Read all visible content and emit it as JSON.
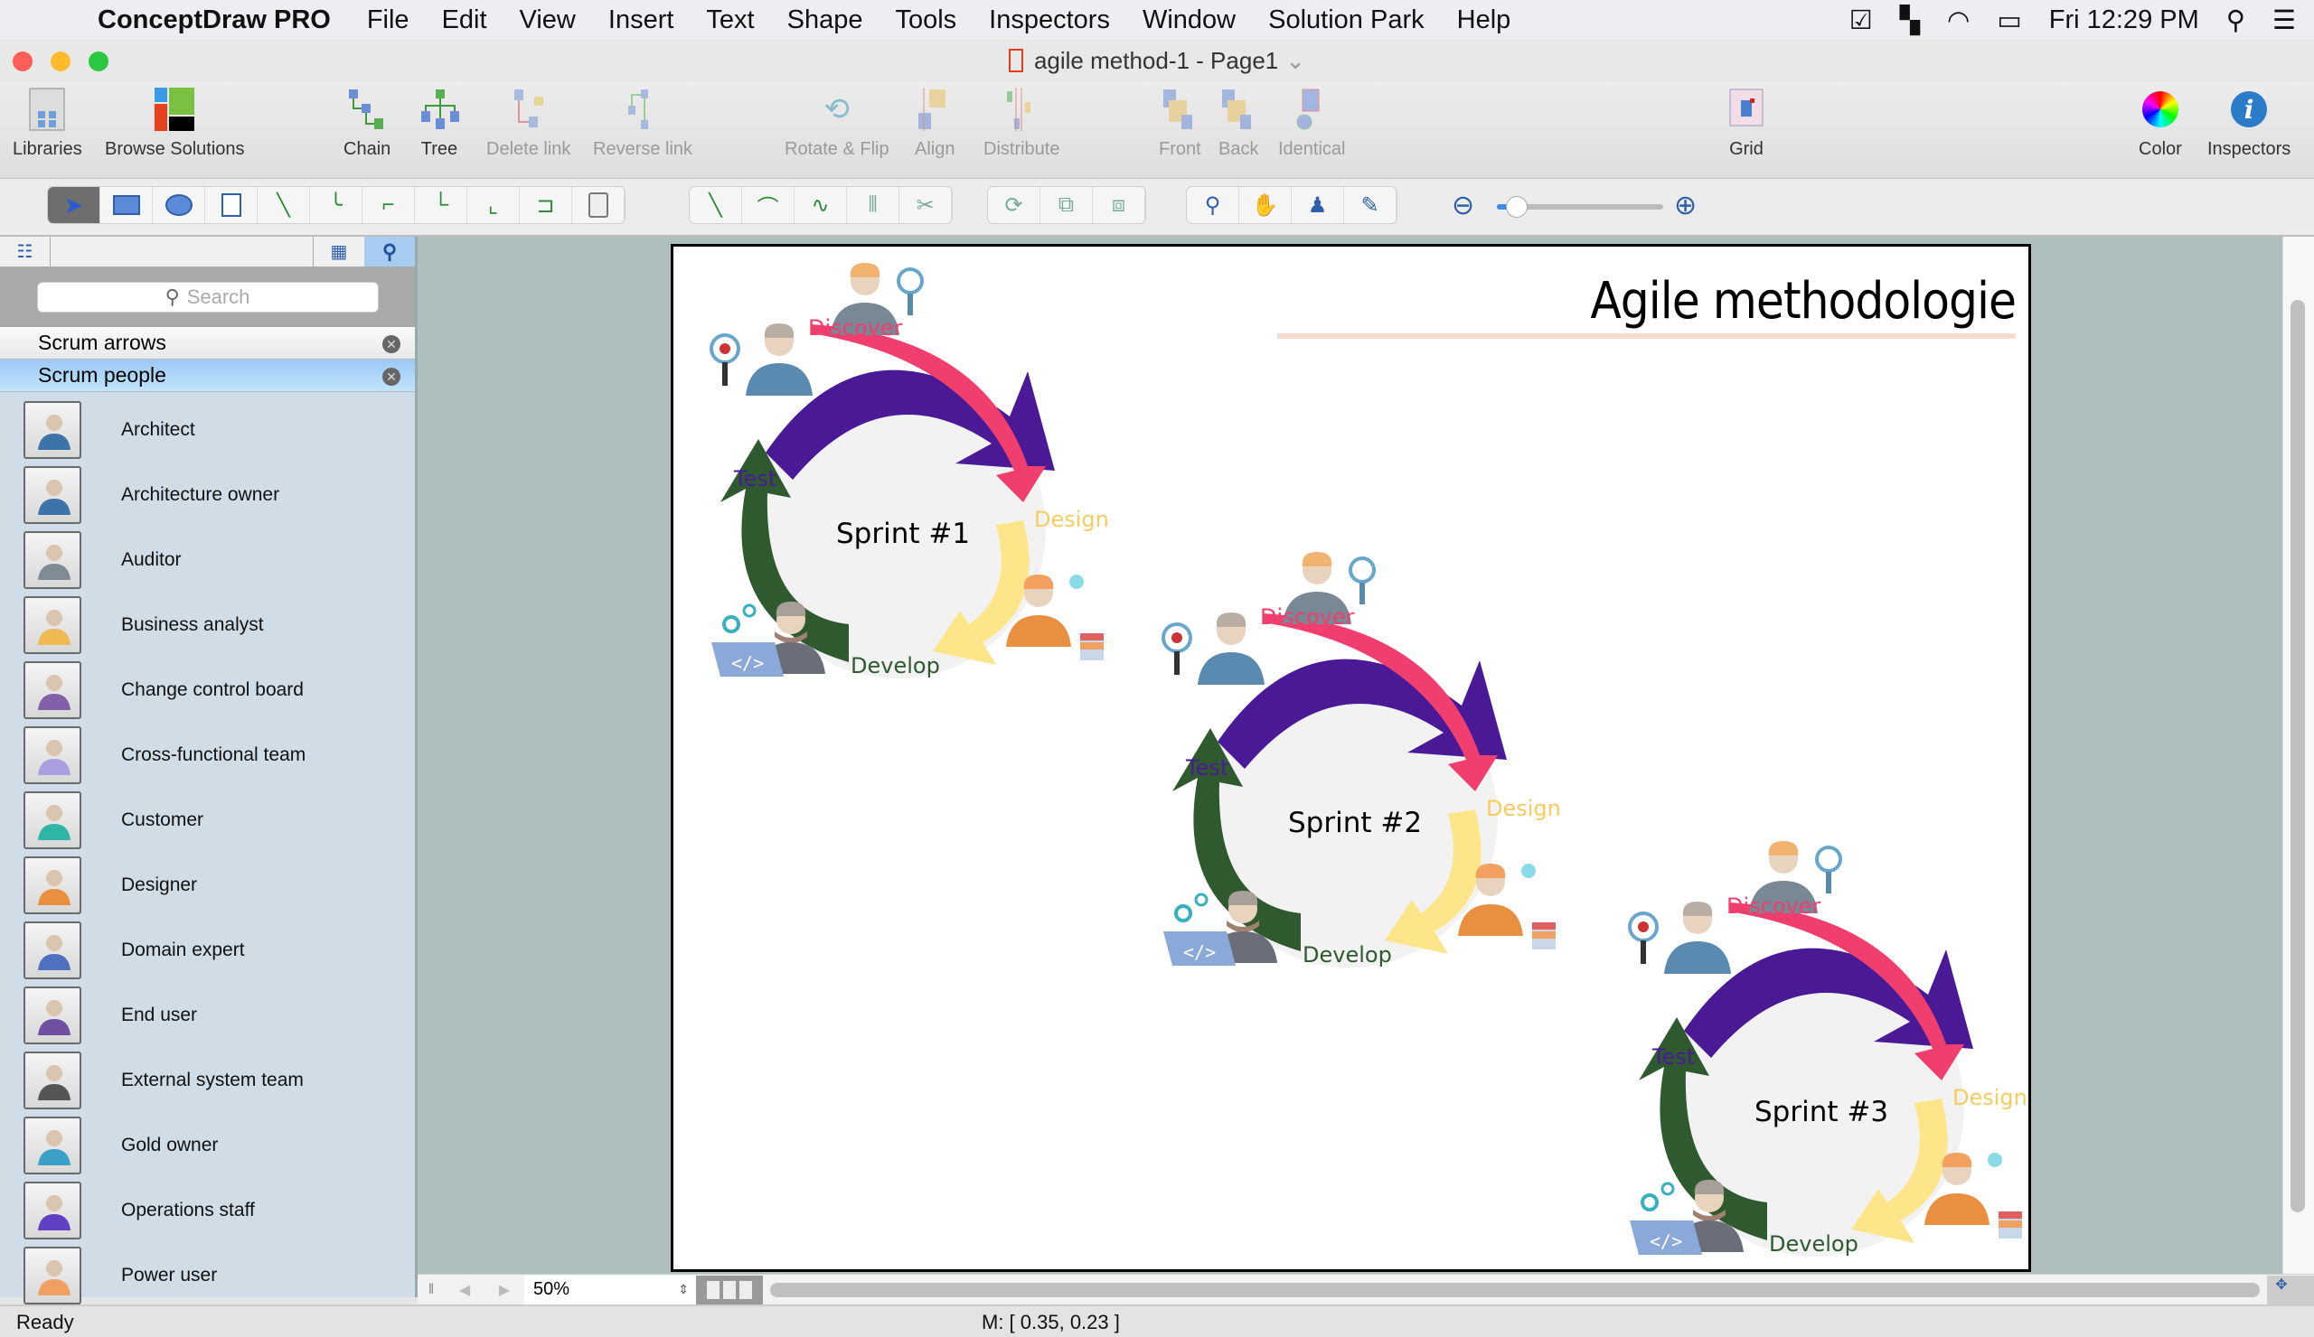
{
  "menubar": {
    "app": "ConceptDraw PRO",
    "items": [
      "File",
      "Edit",
      "View",
      "Insert",
      "Text",
      "Shape",
      "Tools",
      "Inspectors",
      "Window",
      "Solution Park",
      "Help"
    ],
    "clock": "Fri 12:29 PM"
  },
  "window": {
    "title": "agile method-1 - Page1"
  },
  "toolbar": {
    "libraries": "Libraries",
    "browse": "Browse Solutions",
    "chain": "Chain",
    "tree": "Tree",
    "delete_link": "Delete link",
    "reverse_link": "Reverse link",
    "rotate": "Rotate & Flip",
    "align": "Align",
    "distribute": "Distribute",
    "front": "Front",
    "back": "Back",
    "identical": "Identical",
    "grid": "Grid",
    "color": "Color",
    "inspectors": "Inspectors"
  },
  "zoom_slider": {
    "value_fraction": 0.12
  },
  "sidebar": {
    "search_placeholder": "Search",
    "libraries": [
      "Scrum arrows",
      "Scrum people"
    ],
    "items": [
      "Architect",
      "Architecture owner",
      "Auditor",
      "Business analyst",
      "Change control board",
      "Cross-functional team",
      "Customer",
      "Designer",
      "Domain expert",
      "End user",
      "External system team",
      "Gold owner",
      "Operations staff",
      "Power user"
    ]
  },
  "diagram": {
    "title": "Agile methodologie",
    "sprints": [
      {
        "name": "Sprint #1",
        "discover": "Discover",
        "test": "Test",
        "design": "Design",
        "develop": "Develop"
      },
      {
        "name": "Sprint #2",
        "discover": "Discover",
        "test": "Test",
        "design": "Design",
        "develop": "Develop"
      },
      {
        "name": "Sprint #3",
        "discover": "Discover",
        "test": "Test",
        "design": "Design",
        "develop": "Develop"
      }
    ],
    "colors": {
      "discover": "#f03e6e",
      "test": "#4a1a96",
      "design": "#fde68a",
      "develop": "#2f5a30",
      "circle": "#f2f2f2"
    }
  },
  "bottom": {
    "zoom": "50%"
  },
  "status": {
    "text": "Ready",
    "coords": "M: [ 0.35, 0.23 ]"
  }
}
